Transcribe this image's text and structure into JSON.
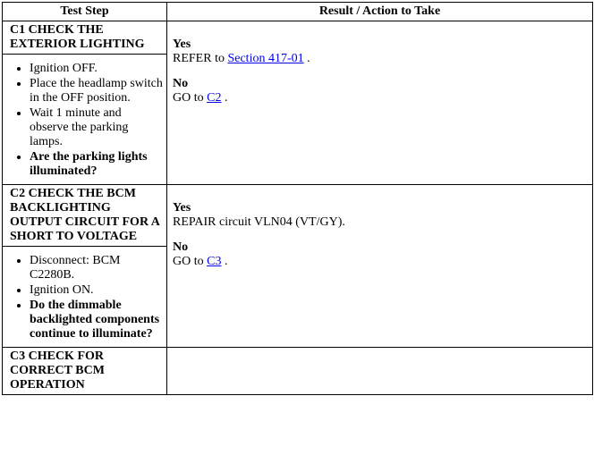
{
  "headers": {
    "col1": "Test Step",
    "col2": "Result / Action to Take"
  },
  "c1": {
    "title": "C1 CHECK THE EXTERIOR LIGHTING",
    "steps": {
      "s1": "Ignition OFF.",
      "s2": "Place the headlamp switch in the OFF position.",
      "s3": "Wait 1 minute and observe the parking lamps.",
      "q": "Are the parking lights illuminated?"
    },
    "result": {
      "yesLabel": "Yes",
      "yesPrefix": "REFER to ",
      "yesLink": "Section 417-01",
      "yesSuffix": " .",
      "noLabel": "No",
      "noPrefix": "GO to ",
      "noLink": "C2",
      "noSuffix": " ."
    }
  },
  "c2": {
    "title": "C2 CHECK THE BCM BACKLIGHTING OUTPUT CIRCUIT FOR A SHORT TO VOLTAGE",
    "steps": {
      "s1": "Disconnect: BCM C2280B.",
      "s2": "Ignition ON.",
      "q": "Do the dimmable backlighted components continue to illuminate?"
    },
    "result": {
      "yesLabel": "Yes",
      "yesText": "REPAIR circuit VLN04 (VT/GY).",
      "noLabel": "No",
      "noPrefix": "GO to ",
      "noLink": "C3",
      "noSuffix": " ."
    }
  },
  "c3": {
    "title": "C3 CHECK FOR CORRECT BCM OPERATION"
  }
}
